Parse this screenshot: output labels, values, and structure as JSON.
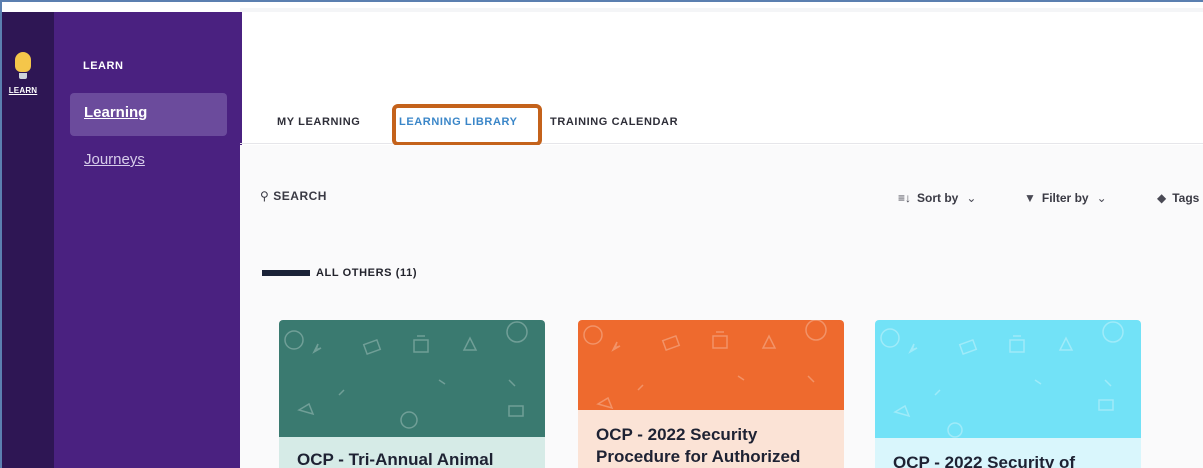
{
  "rail": {
    "app_label": "LEARN",
    "icon": "lightbulb-icon"
  },
  "sidebar": {
    "title": "LEARN",
    "items": [
      {
        "label": "Learning",
        "active": true
      },
      {
        "label": "Journeys",
        "active": false
      }
    ]
  },
  "tabs": [
    {
      "label": "MY LEARNING"
    },
    {
      "label": "LEARNING LIBRARY",
      "active": true
    },
    {
      "label": "TRAINING CALENDAR"
    }
  ],
  "toolbar": {
    "search_label": "SEARCH",
    "sort_label": "Sort by",
    "filter_label": "Filter by",
    "tags_label": "Tags"
  },
  "group": {
    "label": "ALL OTHERS (11)"
  },
  "cards": [
    {
      "title": "OCP - Tri-Annual Animal",
      "color": "#3a7a70"
    },
    {
      "title": "OCP - 2022 Security Procedure for Authorized",
      "color": "#ee6a2e"
    },
    {
      "title": "OCP - 2022 Security of",
      "color": "#72e2f7"
    }
  ],
  "colors": {
    "rail": "#2e1654",
    "sidebar": "#4a2180",
    "active_tab": "#3a86c8",
    "highlight": "#c4621b"
  }
}
